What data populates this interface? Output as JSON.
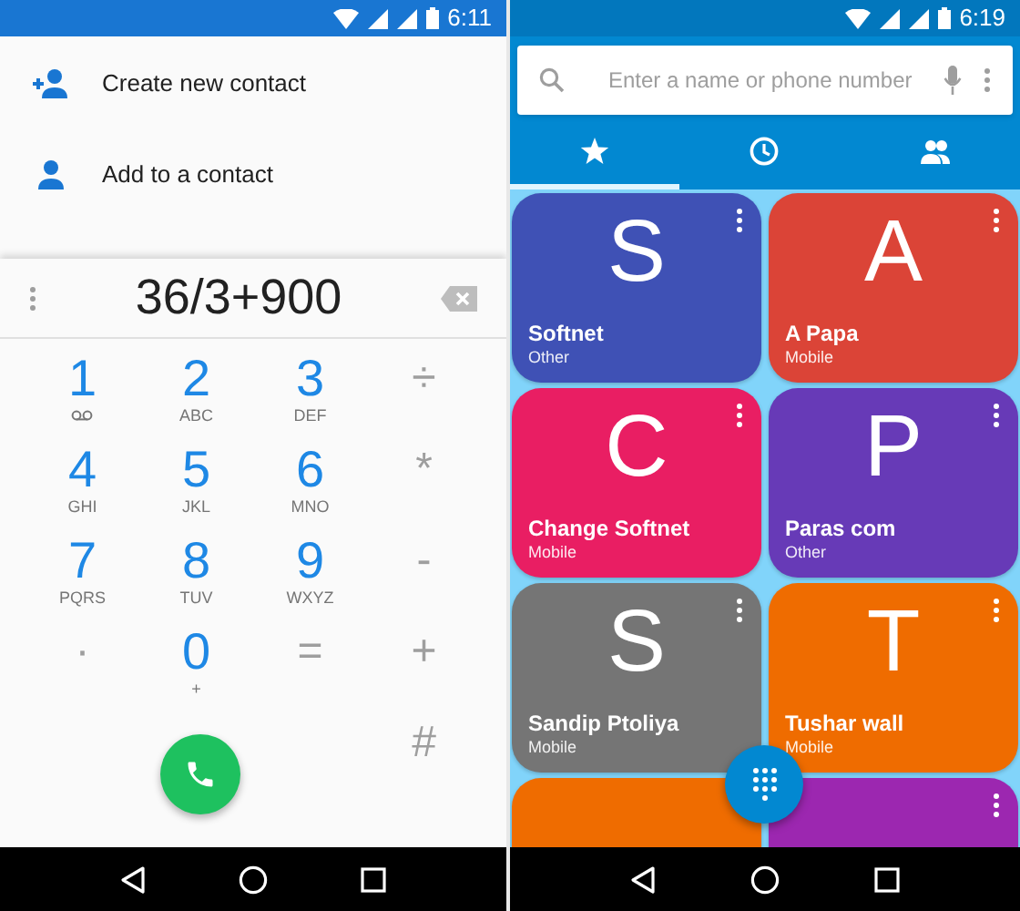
{
  "left_screen": {
    "status_bar": {
      "time": "6:11"
    },
    "menu_items": [
      {
        "label": "Create new contact"
      },
      {
        "label": "Add to a contact"
      }
    ],
    "dial_input": {
      "value": "36/3+900"
    },
    "keys": [
      {
        "kind": "digit",
        "main": "1",
        "voicemail": true
      },
      {
        "kind": "digit",
        "main": "2",
        "sub": "ABC"
      },
      {
        "kind": "digit",
        "main": "3",
        "sub": "DEF"
      },
      {
        "kind": "operator",
        "main": "÷"
      },
      {
        "kind": "digit",
        "main": "4",
        "sub": "GHI"
      },
      {
        "kind": "digit",
        "main": "5",
        "sub": "JKL"
      },
      {
        "kind": "digit",
        "main": "6",
        "sub": "MNO"
      },
      {
        "kind": "operator",
        "main": "*"
      },
      {
        "kind": "digit",
        "main": "7",
        "sub": "PQRS"
      },
      {
        "kind": "digit",
        "main": "8",
        "sub": "TUV"
      },
      {
        "kind": "digit",
        "main": "9",
        "sub": "WXYZ"
      },
      {
        "kind": "operator",
        "main": "-"
      },
      {
        "kind": "operator",
        "main": "·"
      },
      {
        "kind": "digit",
        "main": "0",
        "sub": "+"
      },
      {
        "kind": "operator",
        "main": "="
      },
      {
        "kind": "operator",
        "main": "+"
      },
      {
        "kind": "call"
      },
      {
        "kind": "operator",
        "main": "#"
      }
    ]
  },
  "right_screen": {
    "status_bar": {
      "time": "6:19"
    },
    "search": {
      "placeholder": "Enter a name or phone number"
    },
    "tabs": [
      {
        "selected": true
      },
      {
        "selected": false
      },
      {
        "selected": false
      }
    ],
    "contacts": [
      {
        "letter": "S",
        "name": "Softnet",
        "type": "Other",
        "color": "#3f51b5",
        "more_options": true
      },
      {
        "letter": "A",
        "name": "A Papa",
        "type": "Mobile",
        "color": "#db4437",
        "more_options": true
      },
      {
        "letter": "C",
        "name": "Change Softnet",
        "type": "Mobile",
        "color": "#e91e63",
        "more_options": true
      },
      {
        "letter": "P",
        "name": "Paras com",
        "type": "Other",
        "color": "#673ab7",
        "more_options": true
      },
      {
        "letter": "S",
        "name": "Sandip Ptoliya",
        "type": "Mobile",
        "color": "#757575",
        "more_options": true
      },
      {
        "letter": "T",
        "name": "Tushar wall",
        "type": "Mobile",
        "color": "#ef6c00",
        "more_options": true
      },
      {
        "color": "#ef6c00",
        "more_options": false
      },
      {
        "color": "#9c27b0",
        "more_options": true
      }
    ]
  }
}
